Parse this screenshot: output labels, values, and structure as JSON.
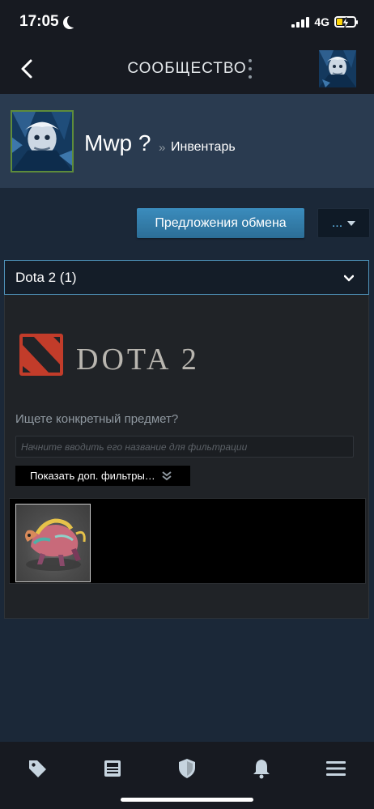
{
  "status_bar": {
    "time": "17:05",
    "network": "4G",
    "icons": [
      "moon-icon",
      "signal-icon",
      "battery-charging-icon"
    ]
  },
  "nav": {
    "title": "СООБЩЕСТВО",
    "icons": [
      "back-icon",
      "more-vertical-icon",
      "avatar"
    ]
  },
  "profile": {
    "name": "Mwp ?",
    "separator": "»",
    "section": "Инвентарь"
  },
  "actions": {
    "trade_offers": "Предложения обмена",
    "more": "..."
  },
  "game_select": {
    "selected": "Dota 2 (1)"
  },
  "inventory": {
    "game_logo_text": "DOTA 2",
    "search_label": "Ищете конкретный предмет?",
    "search_placeholder": "Начните вводить его название для фильтрации",
    "search_value": "",
    "filters_button": "Показать доп. фильтры…",
    "items": [
      {
        "name": "dota-item-creature"
      }
    ]
  },
  "tab_bar": {
    "tabs": [
      "tag-icon",
      "news-icon",
      "shield-icon",
      "bell-icon",
      "menu-icon"
    ]
  },
  "colors": {
    "page_bg": "#1b2838",
    "header_bg": "#171a21",
    "profile_bg": "#2a3b50",
    "accent_blue": "#3b8cbd",
    "avatar_border": "#5e8c3b",
    "select_border": "#4f94bc"
  }
}
